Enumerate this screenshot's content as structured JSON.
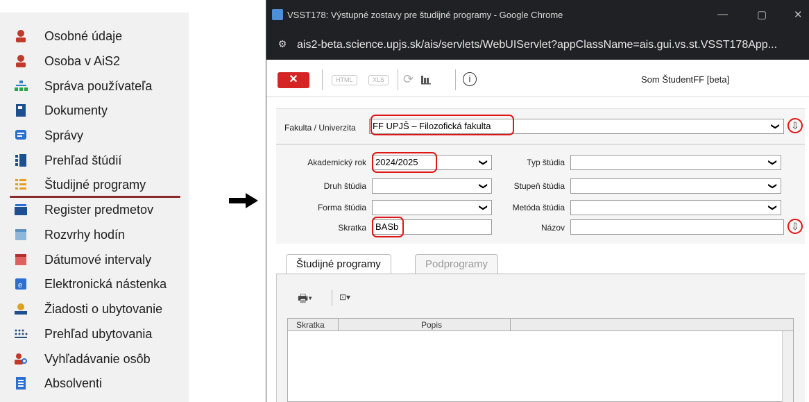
{
  "menu": {
    "items": [
      {
        "label": "Osobné údaje",
        "icon": "person-icon"
      },
      {
        "label": "Osoba v AiS2",
        "icon": "person-icon"
      },
      {
        "label": "Správa používateľa",
        "icon": "org-chart-icon"
      },
      {
        "label": "Dokumenty",
        "icon": "document-icon"
      },
      {
        "label": "Správy",
        "icon": "message-icon"
      },
      {
        "label": "Prehľad štúdií",
        "icon": "study-overview-icon"
      },
      {
        "label": "Študijné programy",
        "icon": "list-icon"
      },
      {
        "label": "Register predmetov",
        "icon": "register-icon"
      },
      {
        "label": "Rozvrhy hodín",
        "icon": "calendar-icon"
      },
      {
        "label": "Dátumové intervaly",
        "icon": "calendar-red-icon"
      },
      {
        "label": "Elektronická nástenka",
        "icon": "board-icon"
      },
      {
        "label": "Žiadosti o ubytovanie",
        "icon": "accommodation-request-icon"
      },
      {
        "label": "Prehľad ubytovania",
        "icon": "dots-grid-icon"
      },
      {
        "label": "Vyhľadávanie osôb",
        "icon": "person-search-icon"
      },
      {
        "label": "Absolventi",
        "icon": "graduate-icon"
      }
    ]
  },
  "window": {
    "title": "VSST178: Výstupné zostavy pre študijné programy - Google Chrome",
    "url": "ais2-beta.science.upjs.sk/ais/servlets/WebUIServlet?appClassName=ais.gui.vs.st.VSST178App...",
    "controls": {
      "minimize": "—",
      "maximize": "▢",
      "close": "✕"
    }
  },
  "toolbar": {
    "close_label": "✕",
    "html_label": "HTML",
    "xls_label": "XLS",
    "user": "Som ŠtudentFF [beta]"
  },
  "filter": {
    "fakulta_label": "Fakulta / Univerzita",
    "fakulta_value": "FF UPJŠ – Filozofická fakulta",
    "akad_rok_label": "Akademický rok",
    "akad_rok_value": "2024/2025",
    "typ_label": "Typ štúdia",
    "druh_label": "Druh štúdia",
    "stupen_label": "Stupeň štúdia",
    "forma_label": "Forma štúdia",
    "metoda_label": "Metóda štúdia",
    "skratka_label": "Skratka",
    "skratka_value": "BASb",
    "nazov_label": "Názov"
  },
  "tabs": {
    "tab1": "Študijné programy",
    "tab2": "Podprogramy"
  },
  "grid": {
    "columns": [
      "Skratka",
      "Popis"
    ]
  },
  "colors": {
    "accent_red": "#e01616",
    "close_btn": "#d52424",
    "titlebar": "#202124"
  }
}
